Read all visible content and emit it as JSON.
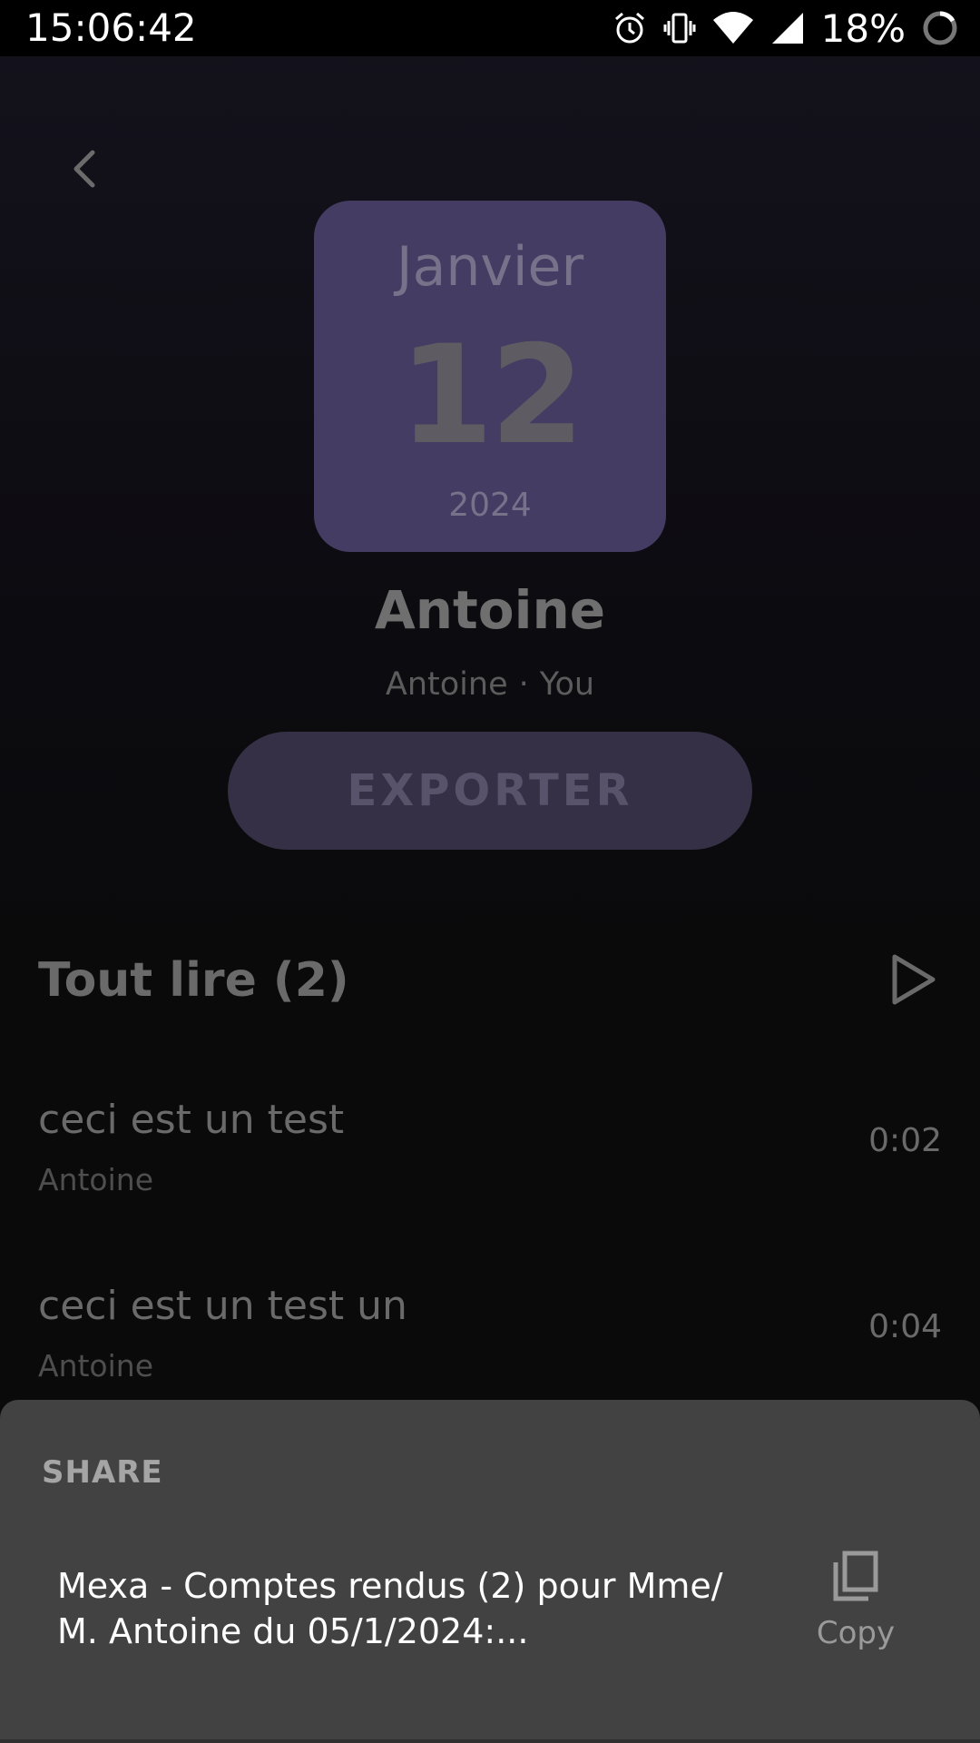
{
  "status_bar": {
    "time": "15:06:42",
    "battery_percent": "18%",
    "icons": [
      "alarm-icon",
      "vibrate-icon",
      "wifi-icon",
      "signal-icon",
      "battery-icon"
    ]
  },
  "header": {
    "back_icon": "chevron-left-icon"
  },
  "date_card": {
    "month": "Janvier",
    "day": "12",
    "year": "2024",
    "color": "#453c63"
  },
  "contact": {
    "name": "Antoine",
    "subtitle_name": "Antoine",
    "separator": "·",
    "subtitle_owner": "You"
  },
  "actions": {
    "export_label": "EXPORTER"
  },
  "playlist": {
    "play_all_label": "Tout lire (2)",
    "play_icon": "play-icon",
    "tracks": [
      {
        "title": "ceci est un test",
        "artist": "Antoine",
        "duration": "0:02"
      },
      {
        "title": "ceci est un test un",
        "artist": "Antoine",
        "duration": "0:04"
      }
    ]
  },
  "share_sheet": {
    "heading": "SHARE",
    "text": "Mexa - Comptes rendus (2) pour Mme/\nM. Antoine  du 05/1/2024:...",
    "copy_label": "Copy",
    "copy_icon": "copy-icon"
  }
}
